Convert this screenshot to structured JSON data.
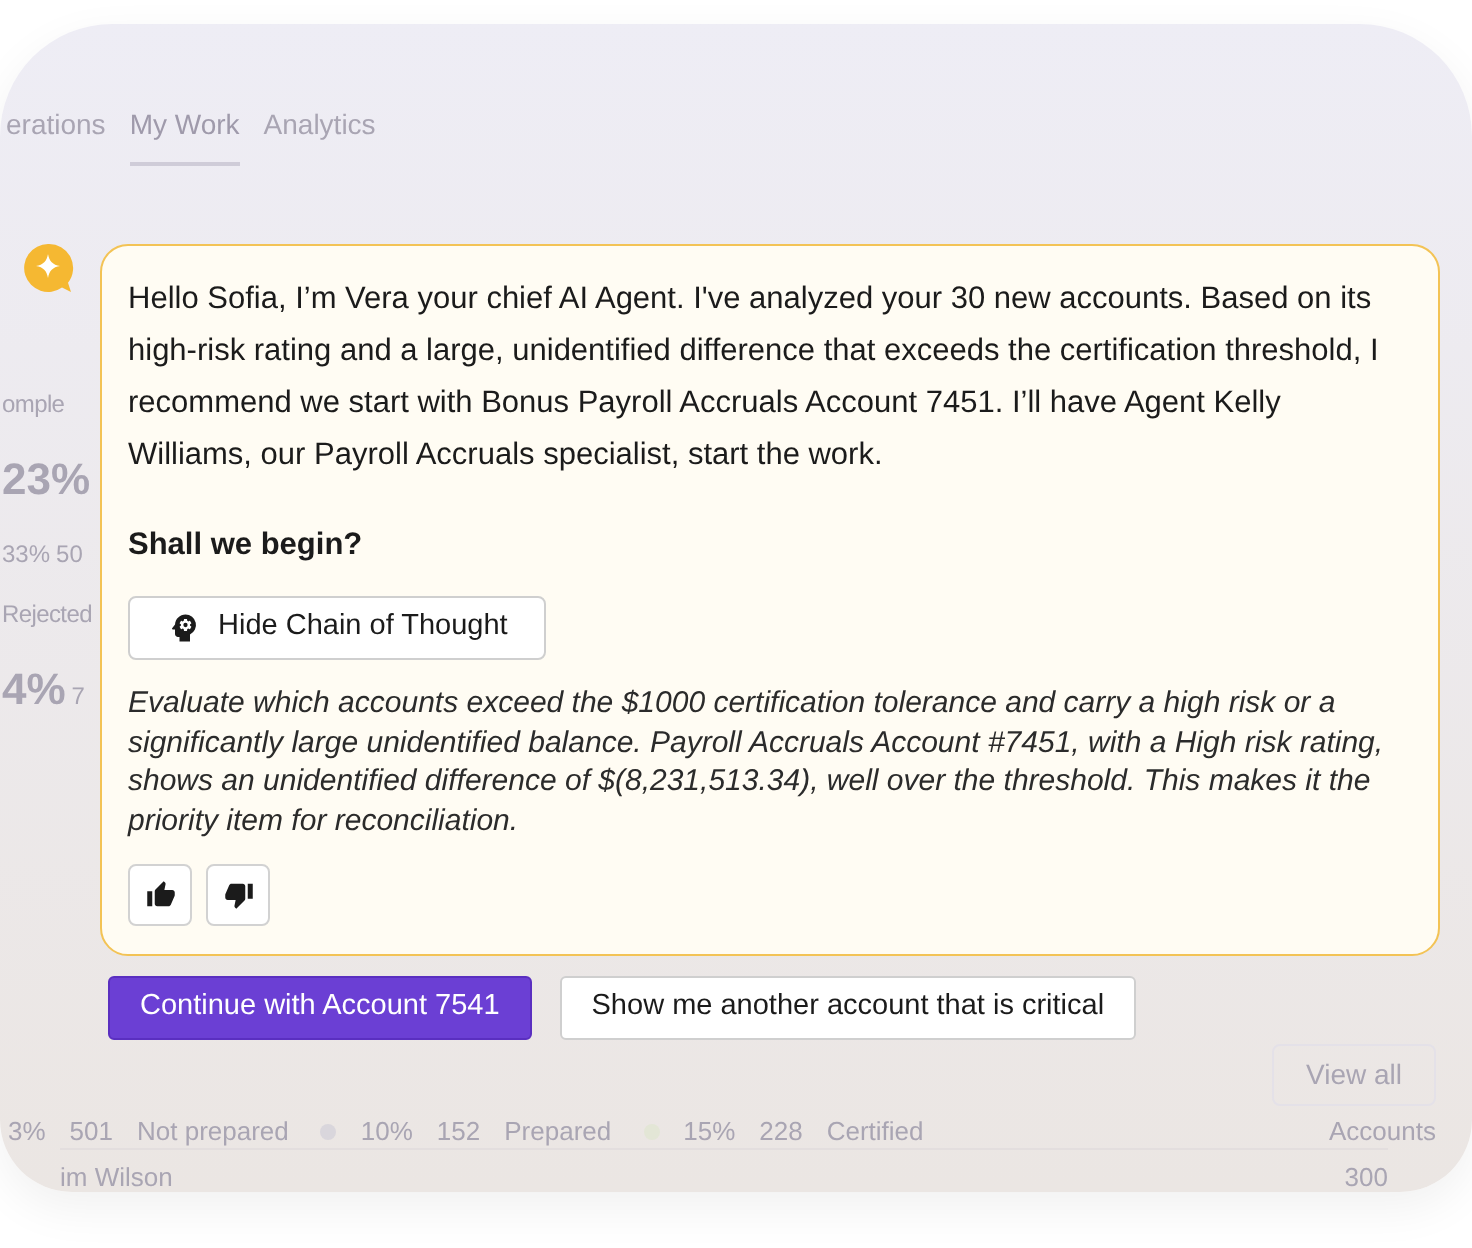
{
  "background": {
    "tabs": [
      {
        "label": "erations",
        "selected": false
      },
      {
        "label": "My Work",
        "selected": true
      },
      {
        "label": "Analytics",
        "selected": false
      }
    ],
    "left_column": [
      {
        "kind": "label",
        "texts": [
          "omple"
        ]
      },
      {
        "kind": "big",
        "texts": [
          "23%"
        ]
      },
      {
        "kind": "small",
        "texts": [
          "33%",
          "50"
        ]
      },
      {
        "kind": "label",
        "texts": [
          "Rejected"
        ]
      },
      {
        "kind": "big",
        "texts": [
          "4%",
          "7"
        ]
      }
    ],
    "view_all": "View all",
    "stats": [
      {
        "percent": "3%",
        "count": "501",
        "label": "Not prepared"
      },
      {
        "percent": "10%",
        "count": "152",
        "label": "Prepared",
        "color": "#d9d6dc"
      },
      {
        "percent": "15%",
        "count": "228",
        "label": "Certified",
        "color": "#e3e6d6"
      }
    ],
    "stats_caption": "Accounts",
    "row": {
      "name": "im Wilson",
      "value": "300"
    }
  },
  "assistant": {
    "message": "Hello Sofia, I’m Vera your chief AI Agent. I've analyzed your 30 new accounts. Based on its high-risk rating and a large, unidentified difference that exceeds the certification threshold, I recommend we start with Bonus Payroll Accruals Account 7451. I’ll have Agent Kelly Williams, our Payroll Accruals specialist, start the work.",
    "question": "Shall we begin?",
    "toggle_button": "Hide Chain of Thought",
    "reasoning": "Evaluate which accounts exceed the $1000 certification tolerance and carry a high risk or a significantly large unidentified balance. Payroll Accruals Account #7451, with a High risk rating, shows an unidentified difference of $(8,231,513.34), well over the threshold. This makes it the priority item for reconciliation.",
    "feedback": [
      {
        "kind": "up"
      },
      {
        "kind": "down"
      }
    ]
  },
  "actions": [
    {
      "label": "Continue with Account 7541",
      "kind": "primary"
    },
    {
      "label": "Show me another account that is critical",
      "kind": "secondary"
    }
  ]
}
